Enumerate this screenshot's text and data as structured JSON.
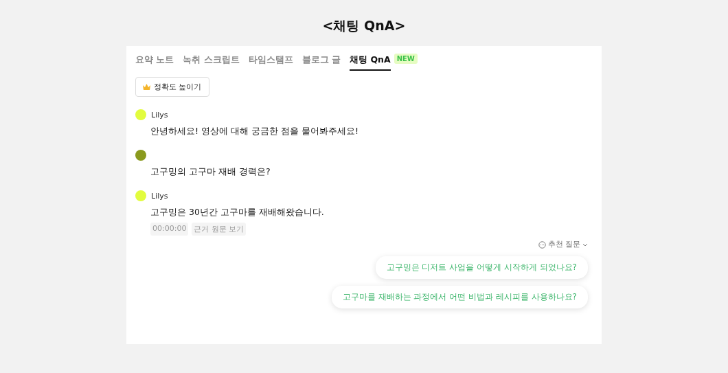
{
  "title": "<채팅 QnA>",
  "tabs": [
    {
      "label": "요약 노트",
      "selected": false
    },
    {
      "label": "녹취 스크립트",
      "selected": false
    },
    {
      "label": "타임스탬프",
      "selected": false
    },
    {
      "label": "블로그 글",
      "selected": false
    },
    {
      "label": "채팅 QnA",
      "selected": true,
      "badge": "NEW"
    }
  ],
  "accuracy_button": "정확도 높이기",
  "messages": [
    {
      "author": "Lilys",
      "color": "#e2fc3e",
      "text": "안녕하세요! 영상에 대해 궁금한 점을 물어봐주세요!"
    },
    {
      "color": "#8a9a1e",
      "text": "고구밍의 고구마 재배 경력은?"
    },
    {
      "author": "Lilys",
      "color": "#e2fc3e",
      "text": "고구밍은 30년간 고구마를 재배해왔습니다.",
      "timestamp": "00:00:00",
      "source_link": "근거 원문 보기"
    }
  ],
  "suggestions": {
    "label": "추천 질문",
    "items": [
      "고구밍은 디저트 사업을 어떻게 시작하게 되었나요?",
      "고구마를 재배하는 과정에서 어떤 비법과 레시피를 사용하나요?"
    ]
  }
}
